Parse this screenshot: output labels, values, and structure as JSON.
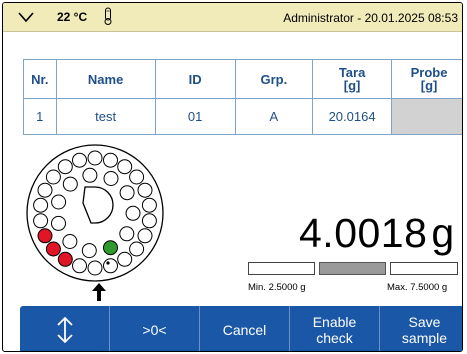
{
  "status": {
    "temperature": "22 °C",
    "user_date": "Administrator - 20.01.2025 08:53",
    "icons": [
      "chevron-down-icon",
      "thermometer-icon"
    ]
  },
  "table": {
    "headers": [
      "Nr.",
      "Name",
      "ID",
      "Grp.",
      "Tara\n[g]",
      "Probe\n[g]"
    ],
    "rows": [
      [
        "1",
        "test",
        "01",
        "A",
        "20.0164",
        ""
      ]
    ]
  },
  "weighing": {
    "value": "4.0018",
    "unit": "g",
    "min_label": "Min. 2.5000 g",
    "max_label": "Max. 7.5000 g"
  },
  "carousel": {
    "positions": 33,
    "colors": {
      "red": "#e01525",
      "green": "#2e9a2e",
      "empty": "#ffffff"
    }
  },
  "buttons": {
    "updown_icon": "up-down-arrows-icon",
    "zero": ">0<",
    "cancel": "Cancel",
    "enable_check": "Enable\ncheck",
    "save_sample": "Save\nsample"
  }
}
